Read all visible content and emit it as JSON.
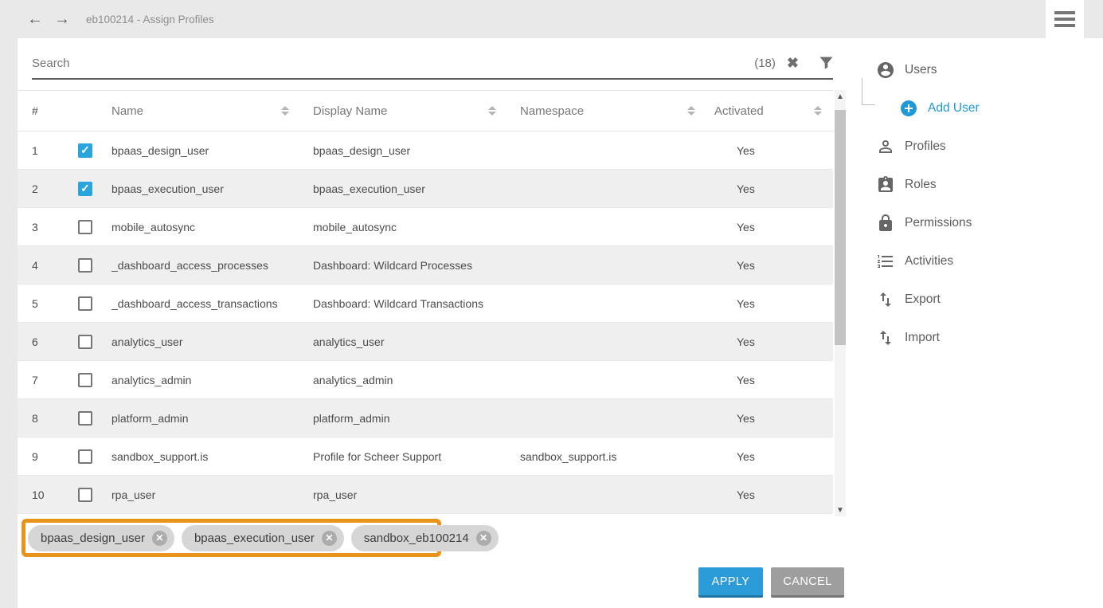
{
  "topbar": {
    "title": "eb100214 - Assign Profiles"
  },
  "search": {
    "placeholder": "Search",
    "count": "(18)"
  },
  "table": {
    "columns": {
      "num": "#",
      "name": "Name",
      "display_name": "Display Name",
      "namespace": "Namespace",
      "activated": "Activated"
    },
    "rows": [
      {
        "num": "1",
        "checked": true,
        "name": "bpaas_design_user",
        "display_name": "bpaas_design_user",
        "namespace": "",
        "activated": "Yes"
      },
      {
        "num": "2",
        "checked": true,
        "name": "bpaas_execution_user",
        "display_name": "bpaas_execution_user",
        "namespace": "",
        "activated": "Yes"
      },
      {
        "num": "3",
        "checked": false,
        "name": "mobile_autosync",
        "display_name": "mobile_autosync",
        "namespace": "",
        "activated": "Yes"
      },
      {
        "num": "4",
        "checked": false,
        "name": "_dashboard_access_processes",
        "display_name": "Dashboard: Wildcard Processes",
        "namespace": "",
        "activated": "Yes"
      },
      {
        "num": "5",
        "checked": false,
        "name": "_dashboard_access_transactions",
        "display_name": "Dashboard: Wildcard Transactions",
        "namespace": "",
        "activated": "Yes"
      },
      {
        "num": "6",
        "checked": false,
        "name": "analytics_user",
        "display_name": "analytics_user",
        "namespace": "",
        "activated": "Yes"
      },
      {
        "num": "7",
        "checked": false,
        "name": "analytics_admin",
        "display_name": "analytics_admin",
        "namespace": "",
        "activated": "Yes"
      },
      {
        "num": "8",
        "checked": false,
        "name": "platform_admin",
        "display_name": "platform_admin",
        "namespace": "",
        "activated": "Yes"
      },
      {
        "num": "9",
        "checked": false,
        "name": "sandbox_support.is",
        "display_name": "Profile for Scheer Support",
        "namespace": "sandbox_support.is",
        "activated": "Yes"
      },
      {
        "num": "10",
        "checked": false,
        "name": "rpa_user",
        "display_name": "rpa_user",
        "namespace": "",
        "activated": "Yes"
      }
    ]
  },
  "chips": [
    "bpaas_design_user",
    "bpaas_execution_user",
    "sandbox_eb100214"
  ],
  "buttons": {
    "apply": "APPLY",
    "cancel": "CANCEL"
  },
  "sidebar": {
    "items": [
      {
        "label": "Users"
      },
      {
        "label": "Add User"
      },
      {
        "label": "Profiles"
      },
      {
        "label": "Roles"
      },
      {
        "label": "Permissions"
      },
      {
        "label": "Activities"
      },
      {
        "label": "Export"
      },
      {
        "label": "Import"
      }
    ]
  },
  "colors": {
    "accent_blue": "#1f9ad6",
    "checkbox_blue": "#2aa4dc",
    "apply_blue": "#2b9cd8",
    "cancel_gray": "#9e9e9e",
    "highlight_orange": "#e8941a",
    "row_alt_gray": "#efefef"
  }
}
